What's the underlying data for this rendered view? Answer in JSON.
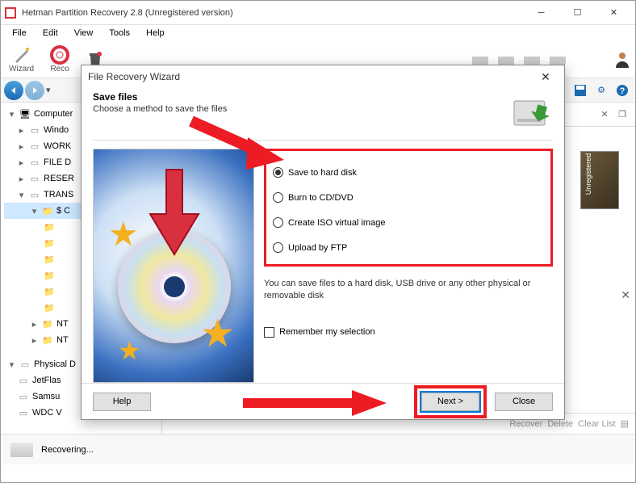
{
  "window": {
    "title": "Hetman Partition Recovery 2.8 (Unregistered version)"
  },
  "menubar": {
    "items": [
      "File",
      "Edit",
      "View",
      "Tools",
      "Help"
    ]
  },
  "toolbar": {
    "wizard": "Wizard",
    "recover": "Reco"
  },
  "tree": {
    "computer": "Computer",
    "windo": "Windo",
    "work": "WORK",
    "filed": "FILE D",
    "reser": "RESER",
    "trans": "TRANS",
    "sc": "$ C",
    "nt1": "NT",
    "nt2": "NT",
    "physical": "Physical D",
    "jetflash": "JetFlas",
    "samsung": "Samsu",
    "wdc": "WDC V"
  },
  "thumb_label": "Unregistered v",
  "statusbar": {
    "recover": "Recover",
    "delete": "Delete",
    "clearlist": "Clear List"
  },
  "footer": {
    "status": "Recovering..."
  },
  "dialog": {
    "title": "File Recovery Wizard",
    "heading": "Save files",
    "subtitle": "Choose a method to save the files",
    "options": {
      "hdd": "Save to hard disk",
      "cd": "Burn to CD/DVD",
      "iso": "Create ISO virtual image",
      "ftp": "Upload by FTP"
    },
    "hint": "You can save files to a hard disk, USB drive or any other physical or removable disk",
    "remember": "Remember my selection",
    "help": "Help",
    "next": "Next >",
    "close": "Close"
  }
}
